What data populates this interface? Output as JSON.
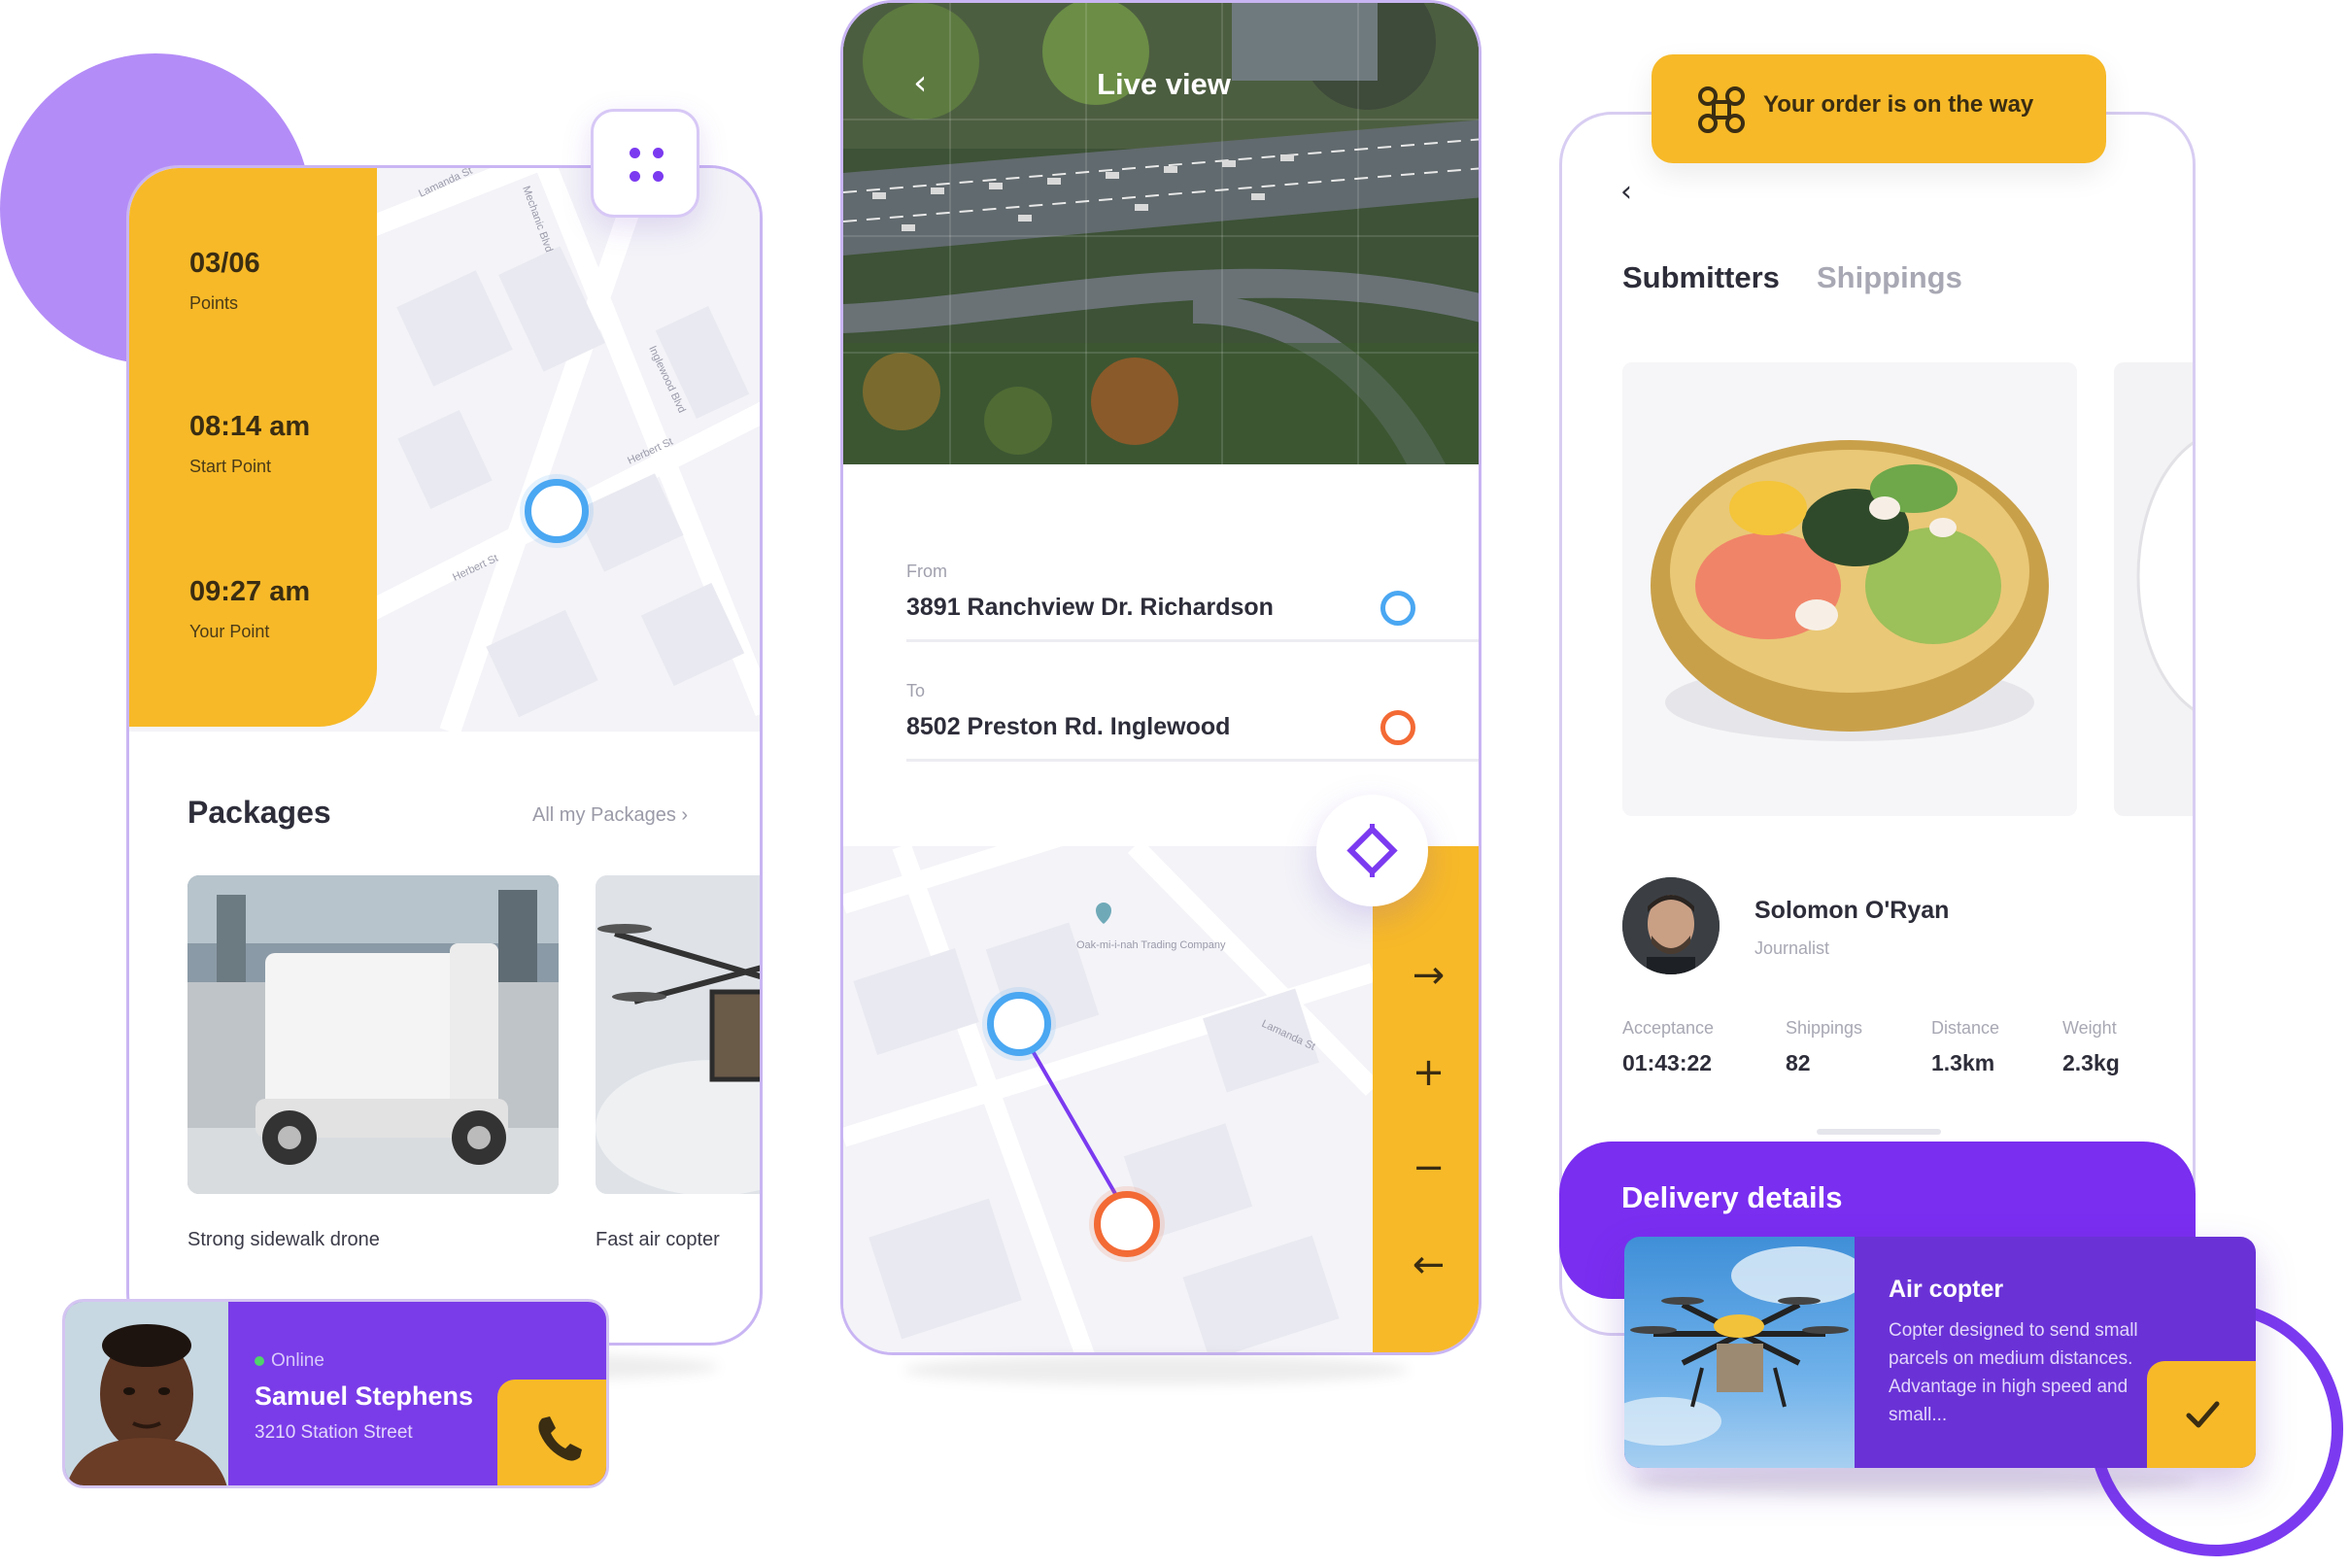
{
  "colors": {
    "accent_yellow": "#f7b928",
    "accent_purple": "#7a2ef0",
    "marker_blue": "#4aa7f2",
    "marker_orange": "#f36a35"
  },
  "screen1": {
    "stats": [
      {
        "value": "03/06",
        "label": "Points"
      },
      {
        "value": "08:14 am",
        "label": "Start Point"
      },
      {
        "value": "09:27 am",
        "label": "Your Point"
      }
    ],
    "map_streets": [
      "Lamanda St",
      "Mechanic Blvd",
      "Inglewood Blvd",
      "Herbert St",
      "Herbert St"
    ],
    "menu_icon": "grid-dots-icon",
    "packages": {
      "title": "Packages",
      "link": "All my Packages",
      "items": [
        {
          "caption": "Strong sidewalk drone"
        },
        {
          "caption": "Fast air copter"
        }
      ]
    },
    "user": {
      "status": "Online",
      "name": "Samuel Stephens",
      "address": "3210  Station Street",
      "call_icon": "phone-icon"
    }
  },
  "screen2": {
    "title": "Live view",
    "from_label": "From",
    "from_value": "3891 Ranchview Dr. Richardson",
    "to_label": "To",
    "to_value": "8502 Preston Rd. Inglewood",
    "map_poi": "Oak-mi-i-nah Trading Company",
    "map_street": "Lamanda St",
    "controls": [
      "arrow-right-icon",
      "plus-icon",
      "minus-icon",
      "arrow-left-icon"
    ]
  },
  "screen3": {
    "banner": "Your order is on the way",
    "tabs": [
      "Submitters",
      "Shippings"
    ],
    "submitter": {
      "name": "Solomon O'Ryan",
      "role": "Journalist"
    },
    "metrics": [
      {
        "label": "Acceptance",
        "value": "01:43:22"
      },
      {
        "label": "Shippings",
        "value": "82"
      },
      {
        "label": "Distance",
        "value": "1.3km"
      },
      {
        "label": "Weight",
        "value": "2.3kg"
      }
    ],
    "delivery_title": "Delivery details",
    "delivery_item": {
      "title": "Air copter",
      "description": "Copter designed to send small parcels on medium distances. Advantage in high speed and small..."
    }
  }
}
